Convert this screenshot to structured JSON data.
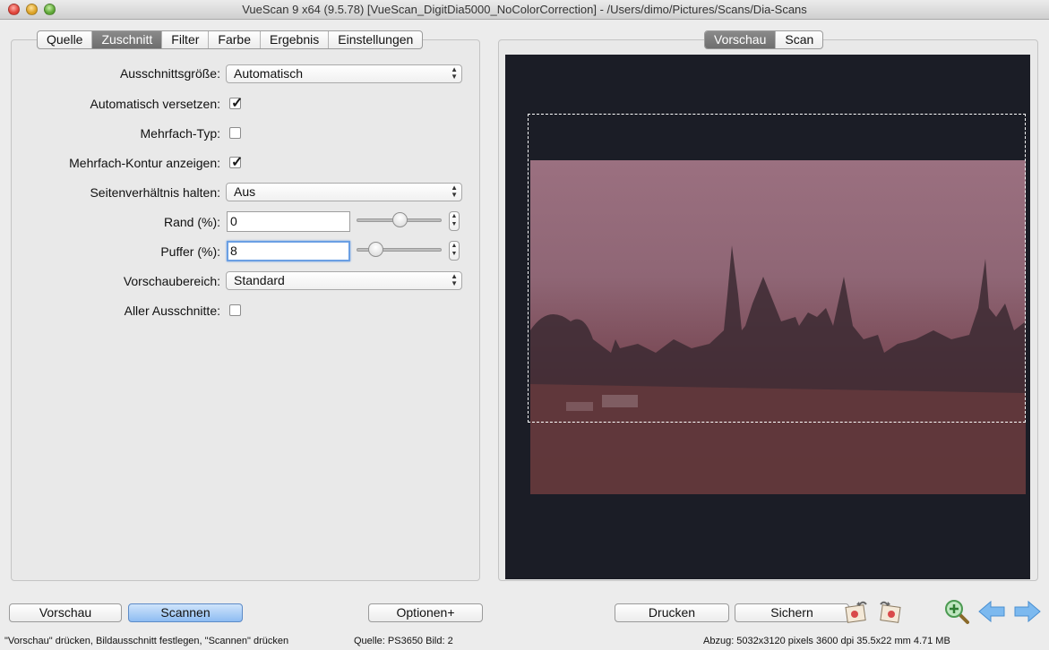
{
  "window": {
    "title": "VueScan 9 x64 (9.5.78) [VueScan_DigitDia5000_NoColorCorrection] - /Users/dimo/Pictures/Scans/Dia-Scans"
  },
  "left_tabs": [
    "Quelle",
    "Zuschnitt",
    "Filter",
    "Farbe",
    "Ergebnis",
    "Einstellungen"
  ],
  "left_active_tab": "Zuschnitt",
  "right_tabs": [
    "Vorschau",
    "Scan"
  ],
  "right_active_tab": "Vorschau",
  "form": {
    "crop_size": {
      "label": "Ausschnittsgröße:",
      "value": "Automatisch"
    },
    "auto_offset": {
      "label": "Automatisch versetzen:",
      "checked": true
    },
    "multi_type": {
      "label": "Mehrfach-Typ:",
      "checked": false
    },
    "multi_outline": {
      "label": "Mehrfach-Kontur anzeigen:",
      "checked": true
    },
    "aspect_ratio": {
      "label": "Seitenverhältnis halten:",
      "value": "Aus"
    },
    "border": {
      "label": "Rand (%):",
      "value": "0",
      "slider_fraction": 0.5
    },
    "buffer": {
      "label": "Puffer (%):",
      "value": "8",
      "slider_fraction": 0.22
    },
    "preview_area": {
      "label": "Vorschaubereich:",
      "value": "Standard"
    },
    "all_crops": {
      "label": "Aller Ausschnitte:",
      "checked": false
    }
  },
  "buttons": {
    "preview": "Vorschau",
    "scan": "Scannen",
    "options": "Optionen+",
    "print": "Drucken",
    "save": "Sichern"
  },
  "icons": {
    "rotate_left": "rotate-left-icon",
    "rotate_right": "rotate-right-icon",
    "zoom_in": "zoom-in-icon",
    "prev": "arrow-left-icon",
    "next": "arrow-right-icon"
  },
  "status": {
    "hint": "\"Vorschau\" drücken, Bildausschnitt festlegen, \"Scannen\" drücken",
    "source": "Quelle: PS3650 Bild: 2",
    "output": "Abzug: 5032x3120 pixels 3600 dpi 35.5x22 mm 4.71 MB"
  },
  "colors": {
    "accent": "#6a9fe3",
    "default_button": "#8ebcf2",
    "preview_background": "#1b1d26",
    "slide_tint": "#8f6675"
  }
}
